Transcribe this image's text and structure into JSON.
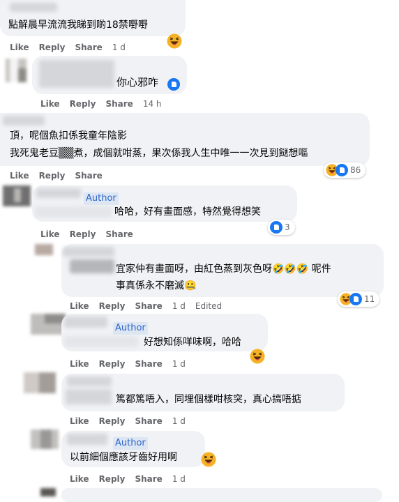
{
  "labels": {
    "like": "Like",
    "reply": "Reply",
    "share": "Share",
    "author": "Author",
    "edited": "Edited"
  },
  "comments": [
    {
      "id": "c1",
      "lines": [
        "點解晨早流流我睇到啲18禁嘢嘢"
      ],
      "time": "1 d"
    },
    {
      "id": "c2",
      "lines": [
        "你心邪咋"
      ],
      "time": "14 h"
    },
    {
      "id": "c3",
      "lines": [
        "頂，呢個魚扣係我童年陰影",
        "我死鬼老豆▒▒煮，成個就咁蒸，果次係我人生中唯一一次見到餸想嘔"
      ],
      "reaction_count": "86"
    },
    {
      "id": "c4",
      "lines": [
        "哈哈，好有畫面感，特然覺得想笑"
      ],
      "reaction_count": "3"
    },
    {
      "id": "c5",
      "lines": [
        "宜家仲有畫面呀，由紅色蒸到灰色呀🤣🤣🤣 呢件",
        "事真係永不磨滅🤐"
      ],
      "time": "1 d",
      "reaction_count": "11"
    },
    {
      "id": "c6",
      "lines": [
        "好想知係咩味啊，哈哈"
      ],
      "time": "1 d"
    },
    {
      "id": "c7",
      "lines": [
        "篤都篤唔入，同埋個樣咁核突，真心搞唔掂"
      ],
      "time": "1 d"
    },
    {
      "id": "c8",
      "lines": [
        "以前細個應該牙齒好用啊"
      ],
      "time": "1 d"
    }
  ],
  "colors": {
    "bubble": "#f0f2f5",
    "action": "#65676b",
    "author": "#2d66c9",
    "like": "#1877f2",
    "haha": "#f7b125"
  },
  "icons": [
    "haha-emoji-icon",
    "like-reaction-icon",
    "laugh-cry-emoji-icon",
    "zipper-mouth-emoji-icon"
  ]
}
